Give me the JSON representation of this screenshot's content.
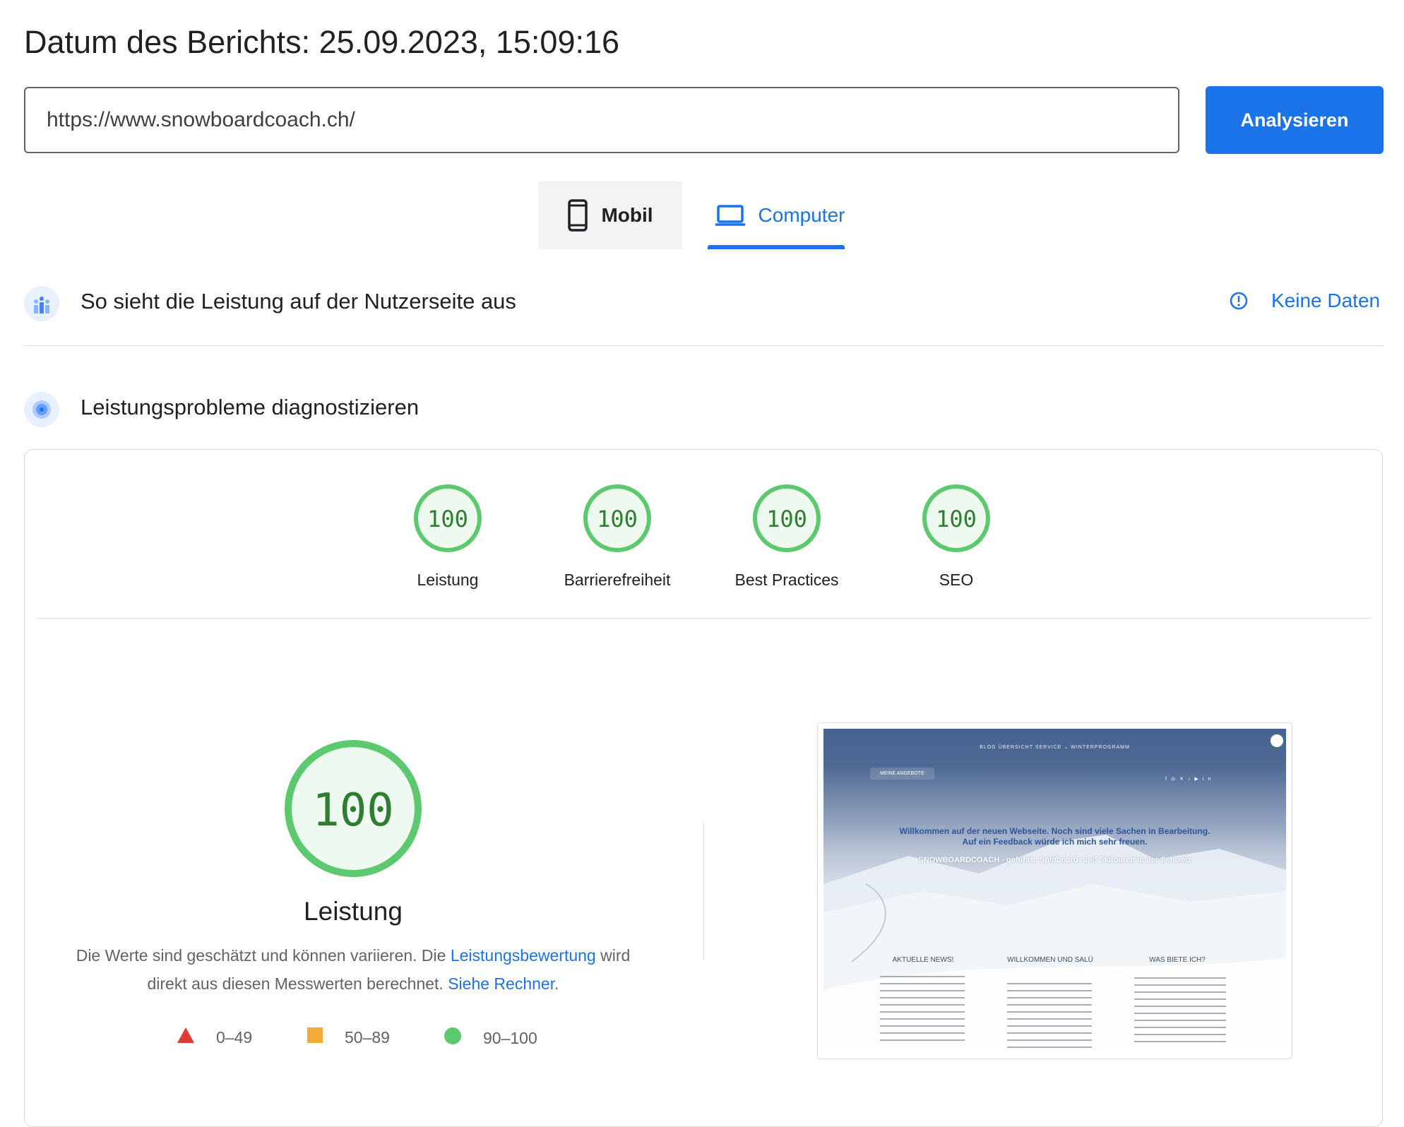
{
  "header": {
    "report_date": "Datum des Berichts: 25.09.2023, 15:09:16"
  },
  "search": {
    "url_value": "https://www.snowboardcoach.ch/",
    "analyze_label": "Analysieren"
  },
  "tabs": [
    {
      "label": "Mobil",
      "icon": "smartphone-icon",
      "active": false
    },
    {
      "label": "Computer",
      "icon": "laptop-icon",
      "active": true
    }
  ],
  "field_data": {
    "title": "So sieht die Leistung auf der Nutzerseite aus",
    "icon": "users-chart-icon",
    "status_label": "Keine Daten",
    "status_icon": "info-icon"
  },
  "diagnose": {
    "title": "Leistungsprobleme diagnostizieren",
    "icon": "target-icon"
  },
  "scores": [
    {
      "label": "Leistung",
      "value": "100"
    },
    {
      "label": "Barrierefreiheit",
      "value": "100"
    },
    {
      "label": "Best Practices",
      "value": "100"
    },
    {
      "label": "SEO",
      "value": "100"
    }
  ],
  "performance": {
    "score": "100",
    "label": "Leistung",
    "desc_part1": "Die Werte sind geschätzt und können variieren. Die ",
    "desc_link1": "Leistungsbewertung",
    "desc_part2": " wird direkt aus diesen Messwerten berechnet. ",
    "desc_link2": "Siehe Rechner",
    "desc_part3": "."
  },
  "legend": [
    {
      "range": "0–49",
      "shape": "triangle",
      "color": "#e53935"
    },
    {
      "range": "50–89",
      "shape": "square",
      "color": "#f4a93b"
    },
    {
      "range": "90–100",
      "shape": "circle",
      "color": "#5cc96f"
    }
  ],
  "screenshot": {
    "nav": "BLOG   ÜBERSICHT   SERVICE ⌄   WINTERPROGRAMM",
    "button": "MEINE ANGEBOTE",
    "headline1": "Willkommen auf der neuen Webseite. Noch sind viele Sachen in Bearbeitung.",
    "headline2": "Auf ein Feedback würde ich mich sehr freuen.",
    "subline": "SNOWBOARDCOACH - geführte Splitboard- und Skitouren in der Schweiz",
    "col1_title": "AKTUELLE NEWS!",
    "col2_title": "WILLKOMMEN UND SALÜ",
    "col3_title": "WAS BIETE ICH?"
  },
  "colors": {
    "accent": "#1a73e8",
    "pass_green": "#5cc96f",
    "pass_text": "#2e7d32"
  }
}
